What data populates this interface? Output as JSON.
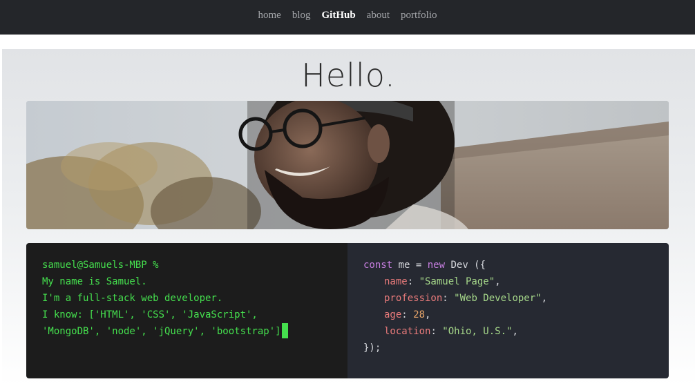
{
  "nav": {
    "items": [
      {
        "label": "home"
      },
      {
        "label": "blog"
      },
      {
        "label": "GitHub"
      },
      {
        "label": "about"
      },
      {
        "label": "portfolio"
      }
    ]
  },
  "hero": {
    "heading": "Hello."
  },
  "terminal": {
    "lines": [
      "samuel@Samuels-MBP %",
      "My name is Samuel.",
      "I'm a full-stack web developer.",
      "I know: ['HTML', 'CSS', 'JavaScript',",
      "'MongoDB', 'node', 'jQuery', 'bootstrap']"
    ]
  },
  "code": {
    "kw_const": "const",
    "var_name": " me = ",
    "kw_new": "new",
    "class_call": " Dev ({",
    "props": [
      {
        "key": "name",
        "sep": ": ",
        "value": "\"Samuel Page\"",
        "kind": "str",
        "end": ","
      },
      {
        "key": "profession",
        "sep": ": ",
        "value": "\"Web Developer\"",
        "kind": "str",
        "end": ","
      },
      {
        "key": "age",
        "sep": ": ",
        "value": "28",
        "kind": "num",
        "end": ","
      },
      {
        "key": "location",
        "sep": ": ",
        "value": "\"Ohio, U.S.\"",
        "kind": "str",
        "end": ","
      }
    ],
    "closing": "});"
  },
  "colors": {
    "navbar_bg": "#24262a",
    "terminal_green": "#45e04e",
    "editor_bg": "#262932",
    "keyword": "#c67ee0",
    "property": "#ea7b7b",
    "string": "#a6d88a",
    "number": "#e9a66a"
  }
}
